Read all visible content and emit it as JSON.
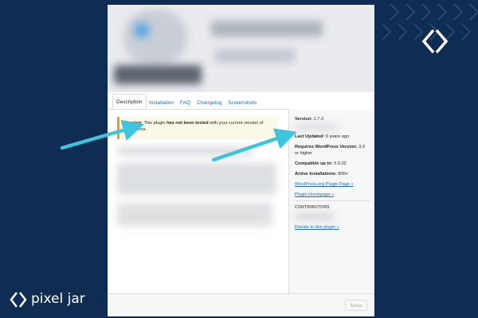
{
  "tabs": [
    "Description",
    "Installation",
    "FAQ",
    "Changelog",
    "Screenshots"
  ],
  "warning": {
    "label": "Warning:",
    "text_before": " This plugin ",
    "emphasis": "has not been tested",
    "text_after": " with your current version of WordPress."
  },
  "sidebar": {
    "version": {
      "label": "Version:",
      "value": "1.7.3"
    },
    "last_updated": {
      "label": "Last Updated:",
      "value": "6 years ago"
    },
    "requires": {
      "label": "Requires WordPress Version:",
      "value": "3.9",
      "value_line2": "or higher"
    },
    "compatible": {
      "label": "Compatible up to:",
      "value": "5.0.22"
    },
    "installs": {
      "label": "Active Installations:",
      "value": "800+"
    },
    "links": [
      "WordPress.org Plugin Page »",
      "Plugin Homepage »"
    ],
    "contributors_heading": "CONTRIBUTORS",
    "donate": "Donate to this plugin »"
  },
  "footer": {
    "action_label": "Active"
  },
  "brand": {
    "name": "pixel jar"
  },
  "colors": {
    "background": "#0f2d52",
    "arrow": "#3ec4dd",
    "link": "#2271b1",
    "warning_border": "#dba617"
  }
}
